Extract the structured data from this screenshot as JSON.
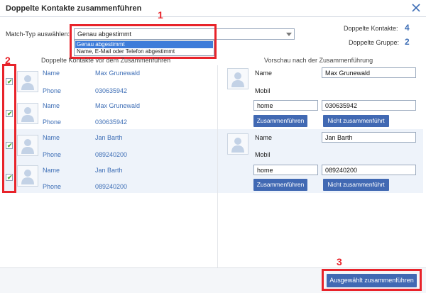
{
  "dialog": {
    "title": "Doppelte Kontakte zusammenführen"
  },
  "match_type": {
    "label": "Match-Typ auswählen:",
    "selected": "Genau abgestimmt",
    "options": [
      "Genau abgestimmt",
      "Name, E-Mail oder Telefon abgestimmt"
    ]
  },
  "stats": {
    "duplicate_contacts_label": "Doppelte Kontakte:",
    "duplicate_contacts_value": "4",
    "duplicate_groups_label": "Doppelte Gruppe:",
    "duplicate_groups_value": "2"
  },
  "columns": {
    "left": "Doppelte Kontakte vor dem Zusammenführen",
    "right": "Vorschau nach der Zusammenführung"
  },
  "annotations": [
    "1",
    "2",
    "3"
  ],
  "contacts": [
    {
      "name_label": "Name",
      "name": "Max Grunewald",
      "phone_label": "Phone",
      "phone": "030635942"
    },
    {
      "name_label": "Name",
      "name": "Max Grunewald",
      "phone_label": "Phone",
      "phone": "030635942"
    },
    {
      "name_label": "Name",
      "name": "Jan Barth",
      "phone_label": "Phone",
      "phone": "089240200"
    },
    {
      "name_label": "Name",
      "name": "Jan Barth",
      "phone_label": "Phone",
      "phone": "089240200"
    }
  ],
  "previews": [
    {
      "name_label": "Name",
      "name": "Max Grunewald",
      "mobile_label": "Mobil",
      "phone_type": "home",
      "phone": "030635942",
      "merge_label": "Zusammenführen",
      "no_merge_label": "Nicht zusammenführt"
    },
    {
      "name_label": "Name",
      "name": "Jan Barth",
      "mobile_label": "Mobil",
      "phone_type": "home",
      "phone": "089240200",
      "merge_label": "Zusammenführen",
      "no_merge_label": "Nicht zusammenführt"
    }
  ],
  "footer": {
    "merge_selected_label": "Ausgewählt zusammenführen"
  },
  "colors": {
    "accent": "#4169b3",
    "link": "#3f6fb6",
    "annotation": "#e8232a",
    "check": "#4ba83a"
  }
}
